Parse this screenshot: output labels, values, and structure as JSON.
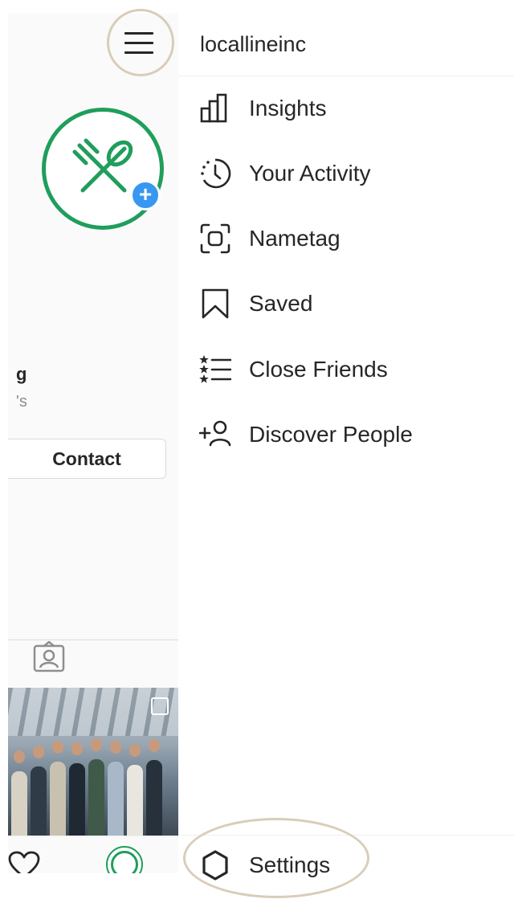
{
  "profile": {
    "name_fragment": "g",
    "sub_fragment": "'s",
    "contact_label": "Contact",
    "add_badge": "+"
  },
  "drawer": {
    "username": "locallineinc",
    "items": [
      {
        "label": "Insights",
        "icon": "insights-icon"
      },
      {
        "label": "Your Activity",
        "icon": "activity-icon"
      },
      {
        "label": "Nametag",
        "icon": "nametag-icon"
      },
      {
        "label": "Saved",
        "icon": "saved-icon"
      },
      {
        "label": "Close Friends",
        "icon": "close-friends-icon"
      },
      {
        "label": "Discover People",
        "icon": "discover-people-icon"
      }
    ],
    "settings_label": "Settings"
  },
  "colors": {
    "brand_green": "#1f9e5c",
    "badge_blue": "#3897f0",
    "highlight_circle": "#d9cdb9",
    "text": "#262626"
  }
}
